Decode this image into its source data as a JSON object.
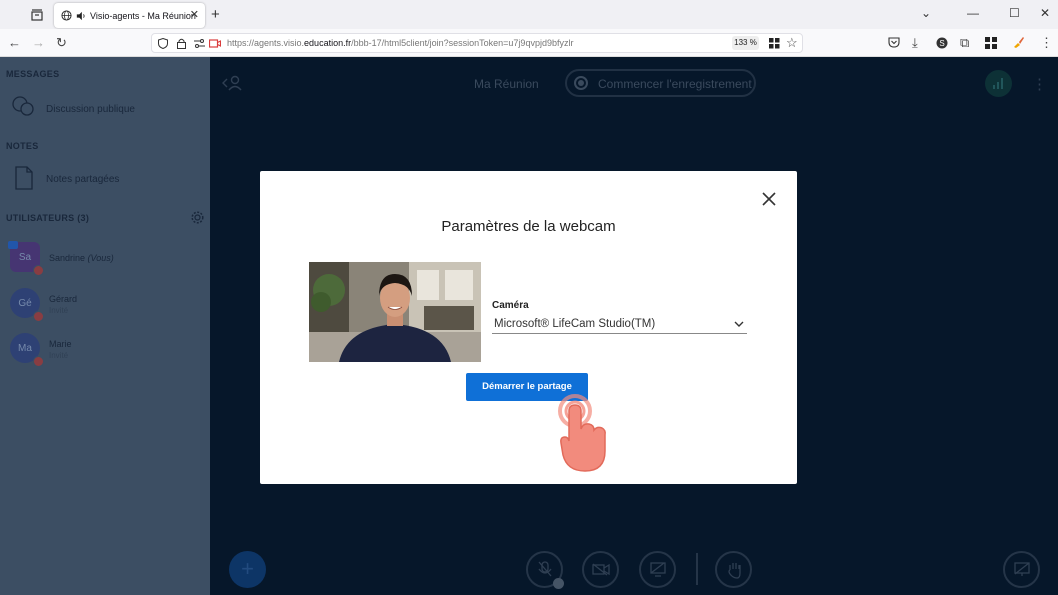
{
  "browser": {
    "tab_title": "Visio-agents - Ma Réunion",
    "url_prefix": "https://agents.visio.",
    "url_domain": "education.fr",
    "url_suffix": "/bbb-17/html5client/join?sessionToken=u7j9qvpjd9bfyzlr",
    "zoom": "133 %"
  },
  "sidebar": {
    "messages_heading": "MESSAGES",
    "public_chat": "Discussion publique",
    "notes_heading": "NOTES",
    "shared_notes": "Notes partagées",
    "users_heading": "UTILISATEURS (3)",
    "users": [
      {
        "initials": "Sa",
        "name": "Sandrine",
        "suffix": "(Vous)",
        "role": "",
        "color": "#5b3f8a"
      },
      {
        "initials": "Gé",
        "name": "Gérard",
        "suffix": "",
        "role": "Invité",
        "color": "#3b4f8c"
      },
      {
        "initials": "Ma",
        "name": "Marie",
        "suffix": "",
        "role": "Invité",
        "color": "#3b4f8c"
      }
    ]
  },
  "main": {
    "meeting_title": "Ma Réunion",
    "record_label": "Commencer l'enregistrement"
  },
  "modal": {
    "title": "Paramètres de la webcam",
    "camera_label": "Caméra",
    "camera_value": "Microsoft® LifeCam Studio(TM)",
    "start_button": "Démarrer le partage"
  },
  "colors": {
    "primary_button": "#0f70d7",
    "main_bg": "#06172a",
    "sidebar_bg": "#4e6076",
    "cursor_hand": "#f28b7d"
  }
}
